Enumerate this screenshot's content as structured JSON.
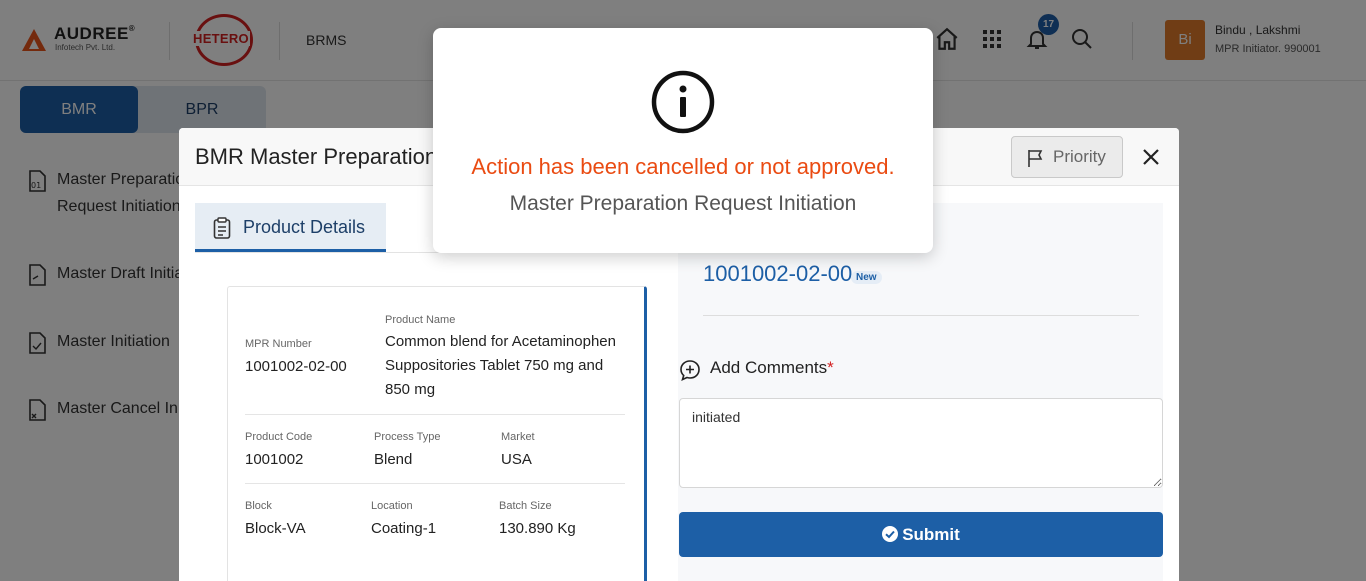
{
  "header": {
    "brand_name": "AUDREE",
    "brand_reg": "®",
    "brand_sub": "Infotech Pvt. Ltd.",
    "partner_logo": "HETERO",
    "app_name": "BRMS",
    "notification_count": "17",
    "user": {
      "initials": "Bi",
      "name": "Bindu , Lakshmi",
      "role": "MPR Initiator. 990001"
    },
    "icons": [
      "home-icon",
      "apps-grid-icon",
      "bell-icon",
      "search-icon"
    ]
  },
  "nav_tabs": {
    "bmr": "BMR",
    "bpr": "BPR"
  },
  "sidebar": {
    "items": [
      {
        "label_line1": "Master Preparation",
        "label_line2": "Request Initiation",
        "icon": "document-01-icon"
      },
      {
        "label_line1": "Master Draft Initiation",
        "icon": "document-draft-icon"
      },
      {
        "label_line1": "Master Initiation",
        "icon": "document-check-icon"
      },
      {
        "label_line1": "Master Cancel Initiation",
        "icon": "document-cancel-icon"
      }
    ]
  },
  "modal": {
    "title": "BMR Master Preparation Request Initiation",
    "priority_label": "Priority",
    "tab_label": "Product Details",
    "product": {
      "mpr_number_label": "MPR Number",
      "mpr_number": "1001002-02-00",
      "product_name_label": "Product Name",
      "product_name": "Common blend for Acetaminophen Suppositories Tablet 750 mg and 850 mg",
      "product_code_label": "Product Code",
      "product_code": "1001002",
      "process_type_label": "Process Type",
      "process_type": "Blend",
      "market_label": "Market",
      "market": "USA",
      "block_label": "Block",
      "block": "Block-VA",
      "location_label": "Location",
      "location": "Coating-1",
      "batch_size_label": "Batch Size",
      "batch_size": "130.890 Kg"
    },
    "status_number": "1001002-02-00",
    "status_tag": "New",
    "comments_label": "Add Comments",
    "comments_required": "*",
    "comments_value": "initiated",
    "submit_label": "Submit"
  },
  "alert": {
    "icon": "info-icon",
    "title": "Action has been cancelled or not approved.",
    "message": "Master Preparation Request Initiation",
    "title_color": "#ea4b12"
  },
  "colors": {
    "primary": "#1d5fa6",
    "accent_orange": "#e07b2a",
    "danger": "#d32020"
  }
}
